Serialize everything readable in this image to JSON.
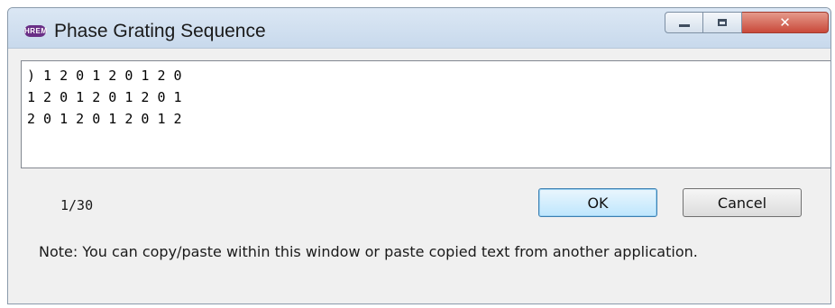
{
  "window": {
    "title": "Phase Grating Sequence",
    "app_icon_text": "HREM"
  },
  "sequence": {
    "lines": [
      ") 1 2 0 1 2 0 1 2 0",
      "1 2 0 1 2 0 1 2 0 1",
      "2 0 1 2 0 1 2 0 1 2"
    ]
  },
  "footer": {
    "counter": "1/30",
    "ok_label": "OK",
    "cancel_label": "Cancel",
    "note": "Note: You can copy/paste within this window or paste copied text from another application."
  },
  "colors": {
    "ok_border": "#3c7fb1",
    "close_button": "#c9493a",
    "app_icon": "#6a2f86"
  },
  "icons": [
    "app-logo-icon",
    "minimize-icon",
    "maximize-icon",
    "close-icon"
  ]
}
